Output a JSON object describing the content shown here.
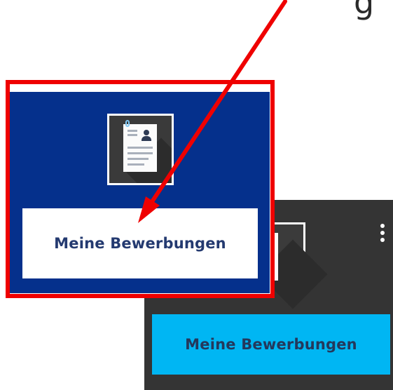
{
  "top_partial_text": "g",
  "tiles": [
    {
      "id": "highlighted",
      "label": "Meine Bewerbungen",
      "background": "#05308c",
      "button_color": "#ffffff",
      "icon": "applications-document-icon",
      "highlighted": true,
      "highlight_color": "#ef0000"
    },
    {
      "id": "background",
      "label": "Meine Bewerbungen",
      "background": "#343434",
      "button_color": "#00b6f3",
      "icon": "applications-document-icon",
      "menu_icon": "kebab-menu-icon"
    }
  ],
  "annotation": {
    "type": "arrow",
    "color": "#ef0000",
    "points_to": "Meine Bewerbungen"
  }
}
